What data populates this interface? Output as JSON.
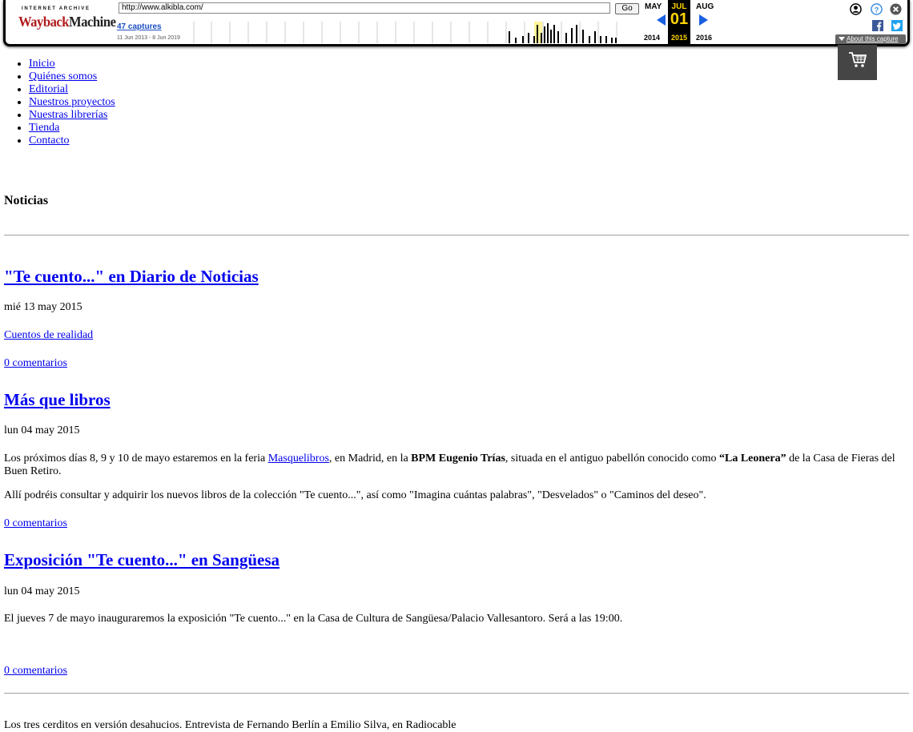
{
  "wayback": {
    "logo_top": "INTERNET ARCHIVE",
    "logo_main_1": "Wayback",
    "logo_main_2": "Machine",
    "url": "http://www.alkibla.com/",
    "go_label": "Go",
    "captures": "47 captures",
    "range": "11 Jun 2013 - 8 Jun 2019",
    "prev_month": "MAY",
    "cur_month": "JUL",
    "next_month": "AUG",
    "cur_day": "01",
    "prev_year": "2014",
    "cur_year": "2015",
    "next_year": "2016",
    "about": "About this capture",
    "icons": [
      "user-icon",
      "help-icon",
      "close-icon",
      "facebook-icon",
      "twitter-icon"
    ],
    "accent": "#1a60e0",
    "highlight": "#ffd400"
  },
  "nav": {
    "items": [
      "Inicio",
      "Quiénes somos",
      "Editorial",
      "Nuestros proyectos",
      "Nuestras librerías",
      "Tienda",
      "Contacto"
    ]
  },
  "cart": {
    "icon": "cart-icon"
  },
  "section_title": "Noticias",
  "posts": [
    {
      "title": "\"Te cuento...\" en Diario de Noticias",
      "date": "mié 13 may 2015",
      "category": "Cuentos de realidad",
      "comments": "0 comentarios"
    },
    {
      "title": "Más que libros",
      "date": "lun 04 may 2015",
      "body1_a": "Los próximos días 8, 9 y 10 de mayo estaremos en la feria ",
      "body1_link": "Masquelibros",
      "body1_b": ", en Madrid, en la ",
      "body1_bold1": "BPM Eugenio Trías",
      "body1_c": ", situada en el antiguo pabellón conocido como ",
      "body1_bold2": "“La Leonera”",
      "body1_d": " de la Casa de Fieras del Buen Retiro.",
      "body2": "Allí podréis consultar y adquirir los nuevos libros de la colección \"Te cuento...\", así como \"Imagina cuántas palabras\", \"Desvelados\" o \"Caminos del deseo\".",
      "comments": "0 comentarios"
    },
    {
      "title": "Exposición \"Te cuento...\" en Sangüesa",
      "date": "lun 04 may 2015",
      "body1": "El jueves 7 de mayo inauguraremos la exposición \"Te cuento...\" en la Casa de Cultura de Sangüesa/Palacio Vallesantoro. Será a las 19:00.",
      "comments": "0 comentarios"
    }
  ],
  "footer_text": "Los tres cerditos en versión desahucios. Entrevista de Fernando Berlín a Emilio Silva, en Radiocable"
}
